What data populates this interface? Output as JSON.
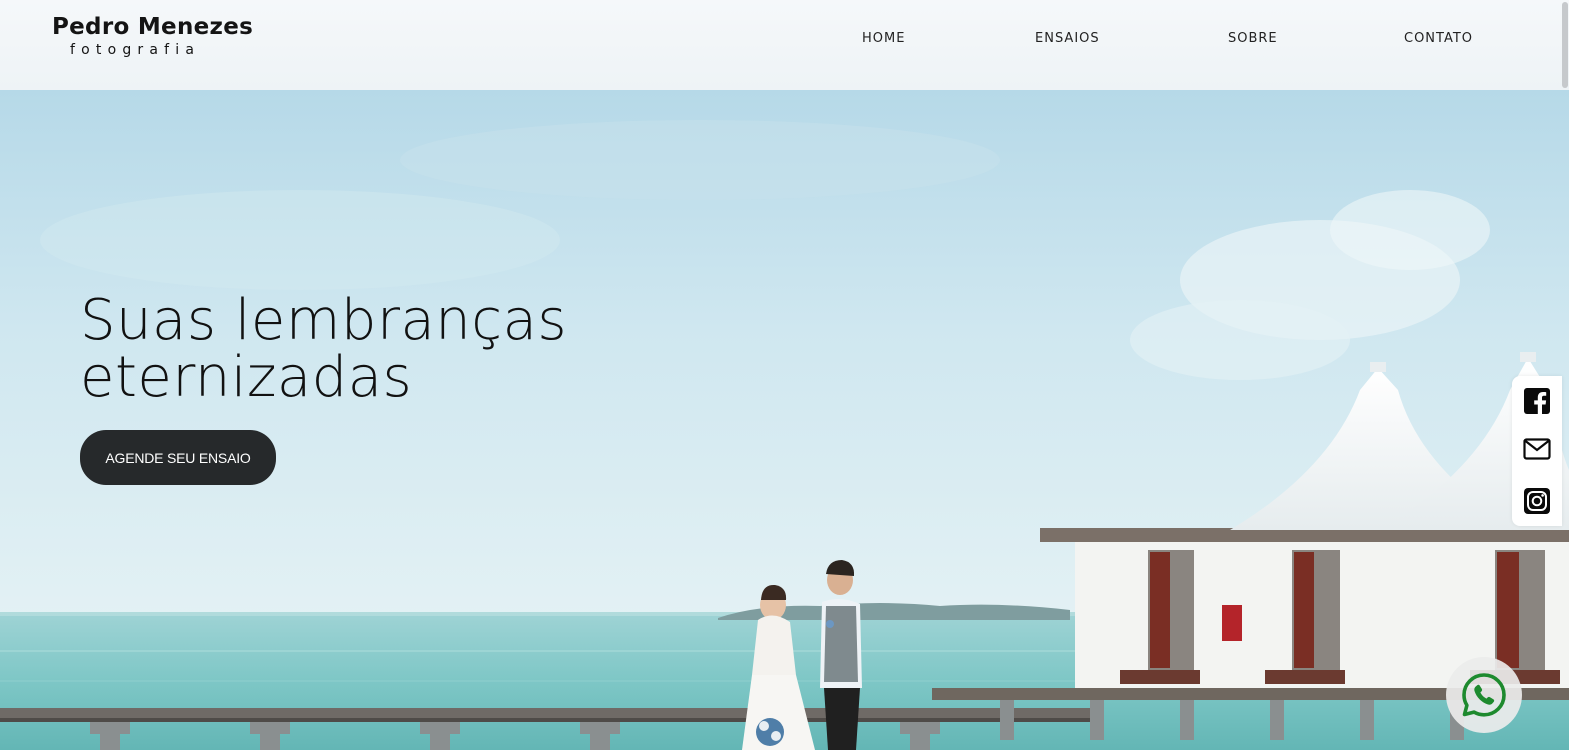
{
  "brand": {
    "name": "Pedro Menezes",
    "tagline": "fotografia"
  },
  "nav": {
    "items": [
      {
        "label": "HOME"
      },
      {
        "label": "ENSAIOS"
      },
      {
        "label": "SOBRE"
      },
      {
        "label": "CONTATO"
      }
    ]
  },
  "hero": {
    "headline_line1": "Suas lembranças",
    "headline_line2": "eternizadas",
    "cta_label": "AGENDE SEU ENSAIO"
  },
  "social": {
    "items": [
      "facebook-icon",
      "mail-icon",
      "instagram-icon"
    ]
  },
  "floating": {
    "icon": "whatsapp-icon",
    "color": "#1e8a2e"
  },
  "colors": {
    "header_bg": "#f3f7f9",
    "button_bg": "#26292b",
    "button_text": "#ffffff",
    "text": "#111111"
  }
}
